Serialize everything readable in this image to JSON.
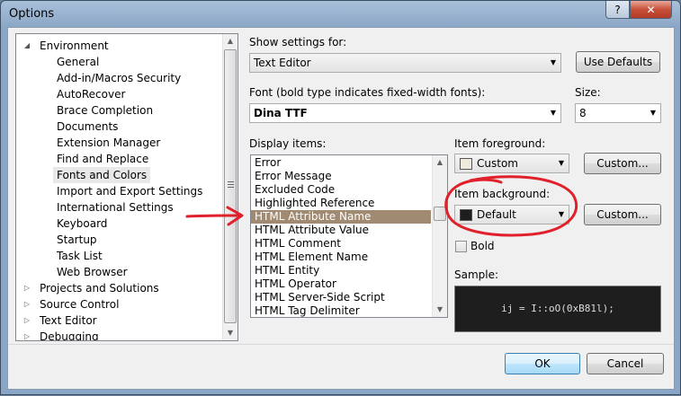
{
  "window": {
    "title": "Options",
    "help_label": "?",
    "close_label": "✕"
  },
  "tree": {
    "items": [
      {
        "label": "Environment",
        "level": 0,
        "expander": "down"
      },
      {
        "label": "General",
        "level": 1
      },
      {
        "label": "Add-in/Macros Security",
        "level": 1
      },
      {
        "label": "AutoRecover",
        "level": 1
      },
      {
        "label": "Brace Completion",
        "level": 1
      },
      {
        "label": "Documents",
        "level": 1
      },
      {
        "label": "Extension Manager",
        "level": 1
      },
      {
        "label": "Find and Replace",
        "level": 1
      },
      {
        "label": "Fonts and Colors",
        "level": 1,
        "selected": true
      },
      {
        "label": "Import and Export Settings",
        "level": 1
      },
      {
        "label": "International Settings",
        "level": 1
      },
      {
        "label": "Keyboard",
        "level": 1
      },
      {
        "label": "Startup",
        "level": 1
      },
      {
        "label": "Task List",
        "level": 1
      },
      {
        "label": "Web Browser",
        "level": 1
      },
      {
        "label": "Projects and Solutions",
        "level": 0,
        "expander": "right"
      },
      {
        "label": "Source Control",
        "level": 0,
        "expander": "right"
      },
      {
        "label": "Text Editor",
        "level": 0,
        "expander": "right"
      },
      {
        "label": "Debugging",
        "level": 0,
        "expander": "right"
      }
    ]
  },
  "settings": {
    "show_settings_label": "Show settings for:",
    "show_settings_value": "Text Editor",
    "use_defaults_label": "Use Defaults",
    "font_label": "Font (bold type indicates fixed-width fonts):",
    "font_value": "Dina TTF",
    "size_label": "Size:",
    "size_value": "8"
  },
  "display_items": {
    "label": "Display items:",
    "items": [
      "Error",
      "Error Message",
      "Excluded Code",
      "Highlighted Reference",
      "HTML Attribute Name",
      "HTML Attribute Value",
      "HTML Comment",
      "HTML Element Name",
      "HTML Entity",
      "HTML Operator",
      "HTML Server-Side Script",
      "HTML Tag Delimiter"
    ],
    "selected_index": 4
  },
  "foreground": {
    "label": "Item foreground:",
    "value": "Custom",
    "swatch_color": "#eeeadc",
    "custom_button": "Custom..."
  },
  "background": {
    "label": "Item background:",
    "value": "Default",
    "swatch_color": "#1e1e1e",
    "custom_button": "Custom..."
  },
  "bold": {
    "label": "Bold",
    "checked": false
  },
  "sample": {
    "label": "Sample:",
    "text": "ij = I::oO(0xB81l);"
  },
  "buttons": {
    "ok": "OK",
    "cancel": "Cancel"
  },
  "annotation_color": "#e0202a"
}
